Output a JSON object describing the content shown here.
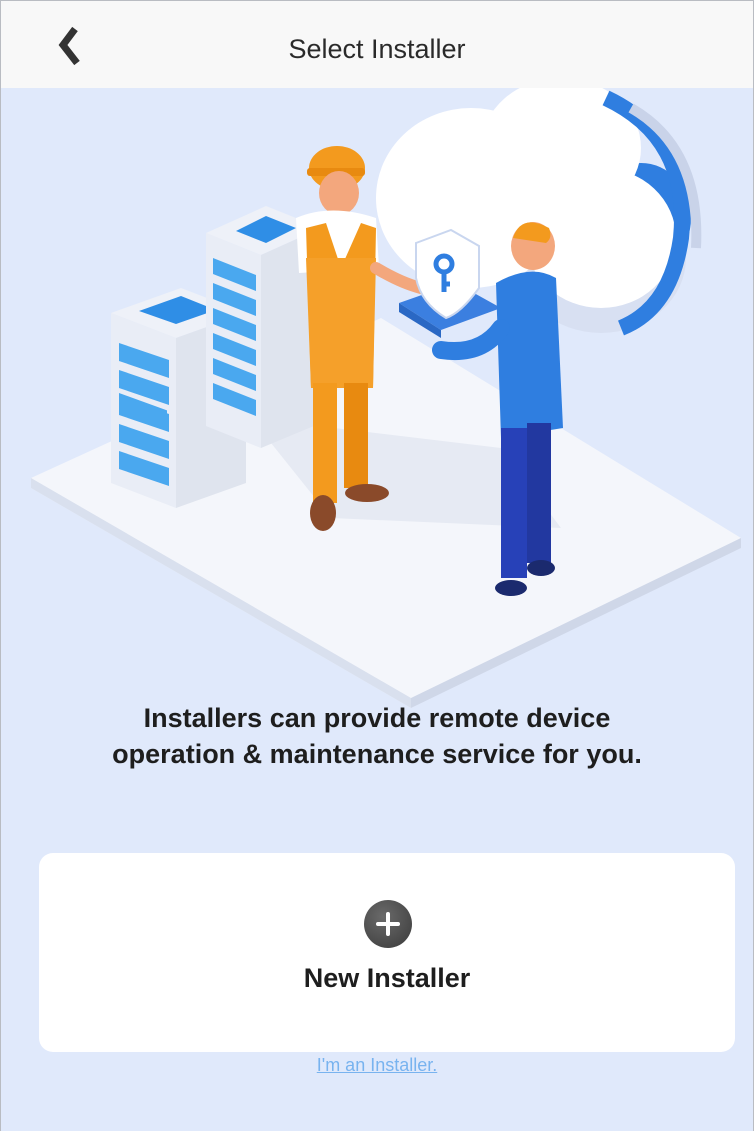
{
  "header": {
    "title": "Select Installer"
  },
  "main": {
    "info_text_line1": "Installers can provide remote device",
    "info_text_line2": "operation & maintenance service for you.",
    "new_installer_label": "New Installer",
    "installer_link": "I'm an Installer."
  },
  "icons": {
    "back": "back-chevron-icon",
    "add": "plus-circle-icon"
  },
  "colors": {
    "background": "#e0e9fb",
    "navbar": "#f8f8f8",
    "link": "#78b3ef",
    "accent_orange": "#f39a1e",
    "accent_blue": "#2f7ee0"
  }
}
